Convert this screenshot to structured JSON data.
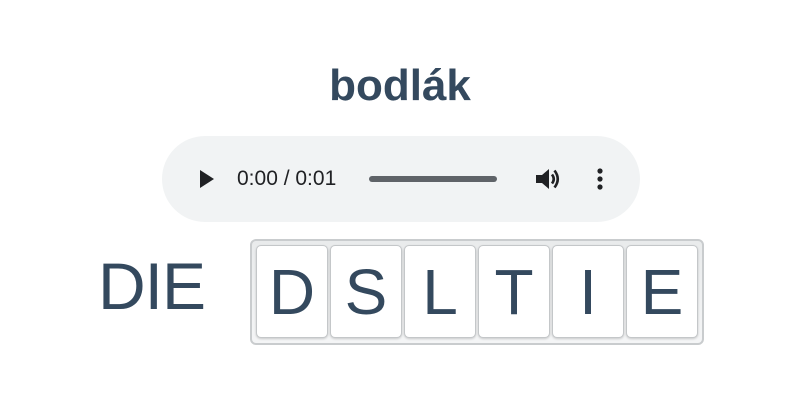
{
  "word": "bodlák",
  "audio": {
    "time": "0:00 / 0:01",
    "progress": 0,
    "icons": {
      "play": "play-icon",
      "volume": "volume-icon",
      "more": "more-vert-icon"
    }
  },
  "article": "DIE",
  "tiles": [
    "D",
    "S",
    "L",
    "T",
    "I",
    "E"
  ],
  "colors": {
    "text": "#34495e",
    "player_bg": "#f1f3f4",
    "tile_border": "#c4c7c9"
  }
}
